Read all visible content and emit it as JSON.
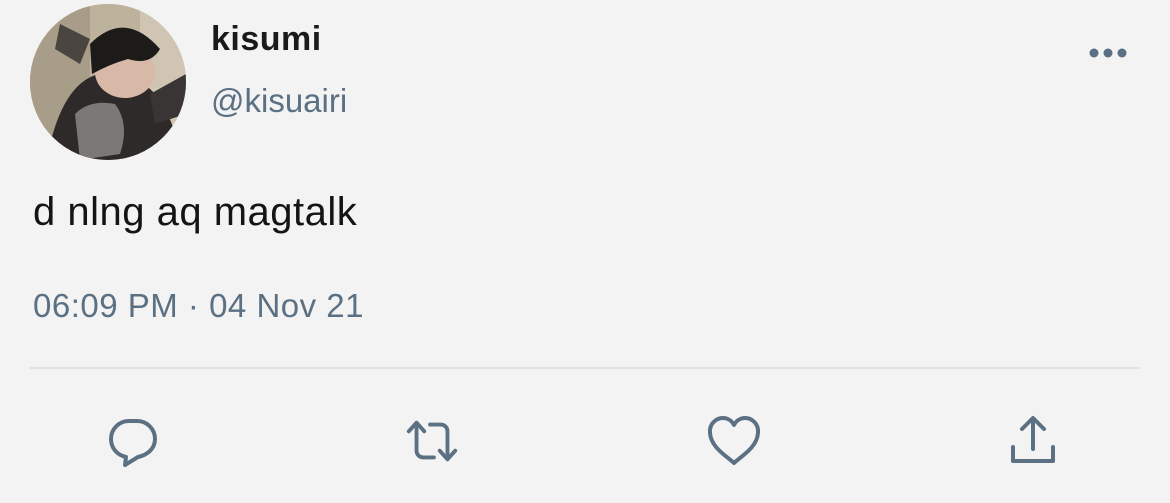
{
  "author": {
    "display_name": "kisumi",
    "handle": "@kisuairi"
  },
  "tweet": {
    "text": "d nlng aq magtalk",
    "timestamp": "06:09 PM · 04 Nov 21"
  },
  "icons": {
    "more": "more-horizontal-icon",
    "reply": "reply-icon",
    "retweet": "retweet-icon",
    "like": "heart-icon",
    "share": "share-icon"
  },
  "colors": {
    "text": "#141414",
    "secondary": "#5b7083",
    "icon": "#5b7083",
    "background": "#f3f3f3"
  }
}
